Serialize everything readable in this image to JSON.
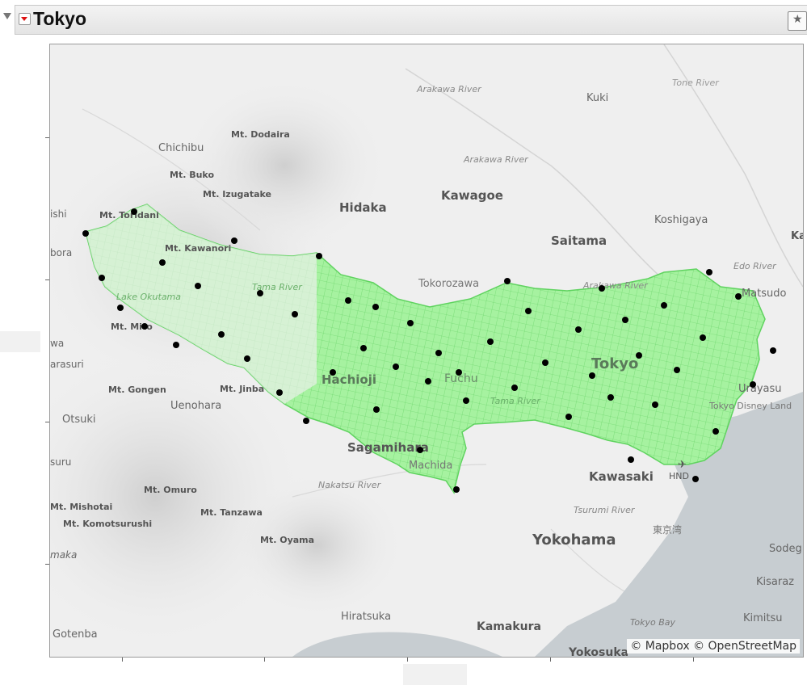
{
  "title": "Tokyo",
  "attribution": "© Mapbox © OpenStreetMap",
  "colors": {
    "region_fill": "#a6f2a0",
    "region_stroke": "#5fd35f",
    "point": "#000000",
    "water": "#c7cdd1",
    "land": "#efefef"
  },
  "icons": {
    "disclosure": "triangle-down-icon",
    "menu": "red-triangle-menu-icon",
    "corner": "pin-star-icon",
    "airport": "airplane-icon"
  },
  "map_labels": {
    "arakawa_river_1": "Arakawa River",
    "tone_river": "Tone River",
    "kuki": "Kuki",
    "mt_dodaira": "Mt. Dodaira",
    "chichibu": "Chichibu",
    "arakawa_river_2": "Arakawa River",
    "mt_buko": "Mt. Buko",
    "mt_izugatake": "Mt. Izugatake",
    "hidaka": "Hidaka",
    "kawagoe": "Kawagoe",
    "koshigaya": "Koshigaya",
    "ishi": "ishi",
    "mt_toridani": "Mt. Toridani",
    "saitama": "Saitama",
    "ka": "Ka",
    "bora": "bora",
    "mt_kawanori": "Mt. Kawanori",
    "edo_river": "Edo River",
    "tama_river_1": "Tama River",
    "tokorozawa": "Tokorozawa",
    "arakawa_river_3": "Arakawa River",
    "lake_okutama": "Lake Okutama",
    "matsudo": "Matsudo",
    "mt_mito": "Mt. Mito",
    "wa": "wa",
    "tokyo": "Tokyo",
    "arasuri": "arasuri",
    "hachioji": "Hachioji",
    "fuchu": "Fuchu",
    "urayasu": "Urayasu",
    "mt_gongen": "Mt. Gongen",
    "mt_jinba": "Mt. Jinba",
    "uenohara": "Uenohara",
    "tama_river_2": "Tama River",
    "tokyo_disney_land": "Tokyo Disney Land",
    "otsuki": "Otsuki",
    "sagamihara": "Sagamihara",
    "suru": "suru",
    "machida": "Machida",
    "kawasaki": "Kawasaki",
    "hnd": "HND",
    "nakatsu_river": "Nakatsu River",
    "mt_omuro": "Mt. Omuro",
    "mt_mishotai": "Mt. Mishotai",
    "tsurumi_river": "Tsurumi River",
    "mt_tanzawa": "Mt. Tanzawa",
    "mt_komotsurushi": "Mt. Komotsurushi",
    "tokyo_bay_jp": "東京湾",
    "mt_oyama": "Mt. Oyama",
    "yokohama": "Yokohama",
    "sodeg": "Sodeg",
    "maka": "maka",
    "kisaraz": "Kisaraz",
    "hiratsuka": "Hiratsuka",
    "tokyo_bay": "Tokyo Bay",
    "kimitsu": "Kimitsu",
    "kamakura": "Kamakura",
    "gotenba": "Gotenba",
    "yokosuka": "Yokosuka"
  },
  "marker_count": 52
}
